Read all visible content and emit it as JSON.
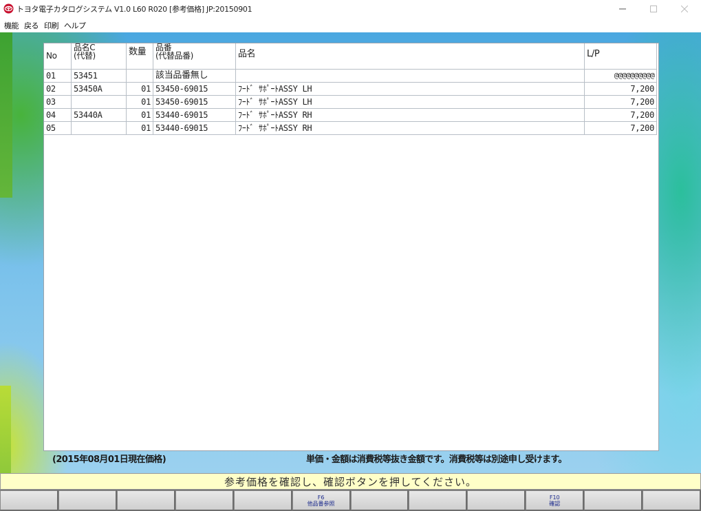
{
  "window": {
    "title": "トヨタ電子カタログシステム V1.0 L60 R020 [参考価格] JP:20150901",
    "icon": "toyota-logo-icon"
  },
  "menu": [
    "機能",
    "戻る",
    "印刷",
    "ヘルプ"
  ],
  "table": {
    "headers": {
      "no": "No",
      "code_line1": "品名C",
      "code_line2": "(代替)",
      "qty": "数量",
      "pn_line1": "品番",
      "pn_line2": "(代替品番)",
      "name": "品名",
      "lp": "L/P"
    },
    "rows": [
      {
        "no": "01",
        "code": "53451",
        "qty": "",
        "pn": "該当品番無し",
        "name": "",
        "lp": "@@@@@@@@@@"
      },
      {
        "no": "02",
        "code": "53450A",
        "qty": "01",
        "pn": "53450-69015",
        "name": "ﾌｰﾄﾞ ｻﾎﾟｰﾄASSY LH",
        "lp": "7,200"
      },
      {
        "no": "03",
        "code": "",
        "qty": "01",
        "pn": "53450-69015",
        "name": "ﾌｰﾄﾞ ｻﾎﾟｰﾄASSY LH",
        "lp": "7,200"
      },
      {
        "no": "04",
        "code": "53440A",
        "qty": "01",
        "pn": "53440-69015",
        "name": "ﾌｰﾄﾞ ｻﾎﾟｰﾄASSY RH",
        "lp": "7,200"
      },
      {
        "no": "05",
        "code": "",
        "qty": "01",
        "pn": "53440-69015",
        "name": "ﾌｰﾄﾞ ｻﾎﾟｰﾄASSY RH",
        "lp": "7,200"
      }
    ]
  },
  "notes": {
    "date": "(2015年08月01日現在価格)",
    "tax": "単価・金額は消費税等抜き金額です。消費税等は別途申し受けます。"
  },
  "status": "参考価格を確認し、確認ボタンを押してください。",
  "fkeys": [
    {
      "key": "",
      "label": ""
    },
    {
      "key": "",
      "label": ""
    },
    {
      "key": "",
      "label": ""
    },
    {
      "key": "",
      "label": ""
    },
    {
      "key": "",
      "label": ""
    },
    {
      "key": "F6",
      "label": "他品番参照"
    },
    {
      "key": "",
      "label": ""
    },
    {
      "key": "",
      "label": ""
    },
    {
      "key": "",
      "label": ""
    },
    {
      "key": "F10",
      "label": "確認"
    },
    {
      "key": "",
      "label": ""
    },
    {
      "key": "",
      "label": ""
    }
  ],
  "colors": {
    "status_bg": "#ffffc8",
    "fkey_text": "#1b2a8c"
  }
}
